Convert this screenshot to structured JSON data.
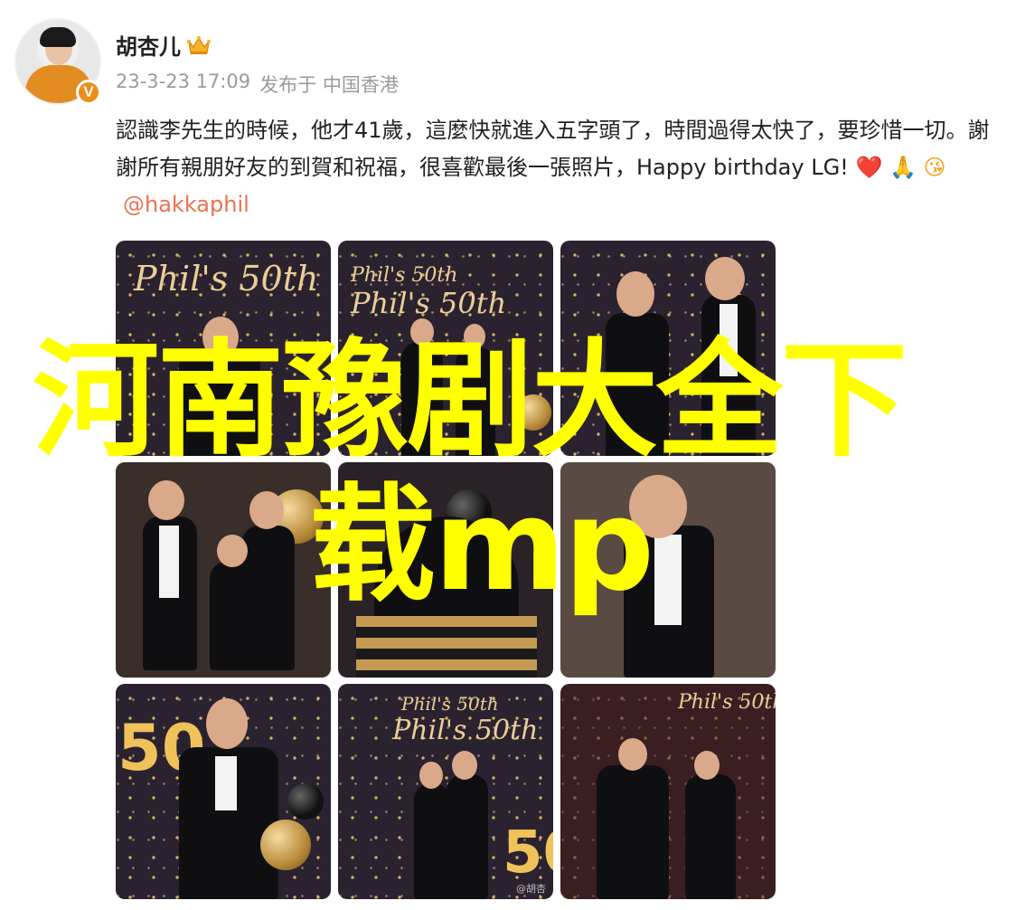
{
  "post": {
    "username": "胡杏儿",
    "timestamp": "23-3-23 17:09",
    "published_from": "发布于 中国香港",
    "text_main": "認識李先生的時候，他才41歲，這麼快就進入五字頭了，時間過得太快了，要珍惜一切。謝謝所有親朋好友的到賀和祝福，很喜歡最後一張照片，Happy birthday LG! ",
    "emoji_heart": "❤️",
    "emoji_pray": "🙏",
    "emoji_kiss": "😘",
    "mention": "@hakkaphil",
    "verified_badge": "V",
    "crown_icon": "crown-icon",
    "accent_color": "#eb7350"
  },
  "photos": {
    "sign_text_1": "Phil's 50th",
    "sign_text_2": "Phil's 50th",
    "sign_text_small": "Phil's 50th",
    "neon_number": "50",
    "watermark": "@胡杏"
  },
  "overlay": {
    "line1": "河南豫剧大全下",
    "line2": "载mp",
    "color": "#ffff00"
  }
}
